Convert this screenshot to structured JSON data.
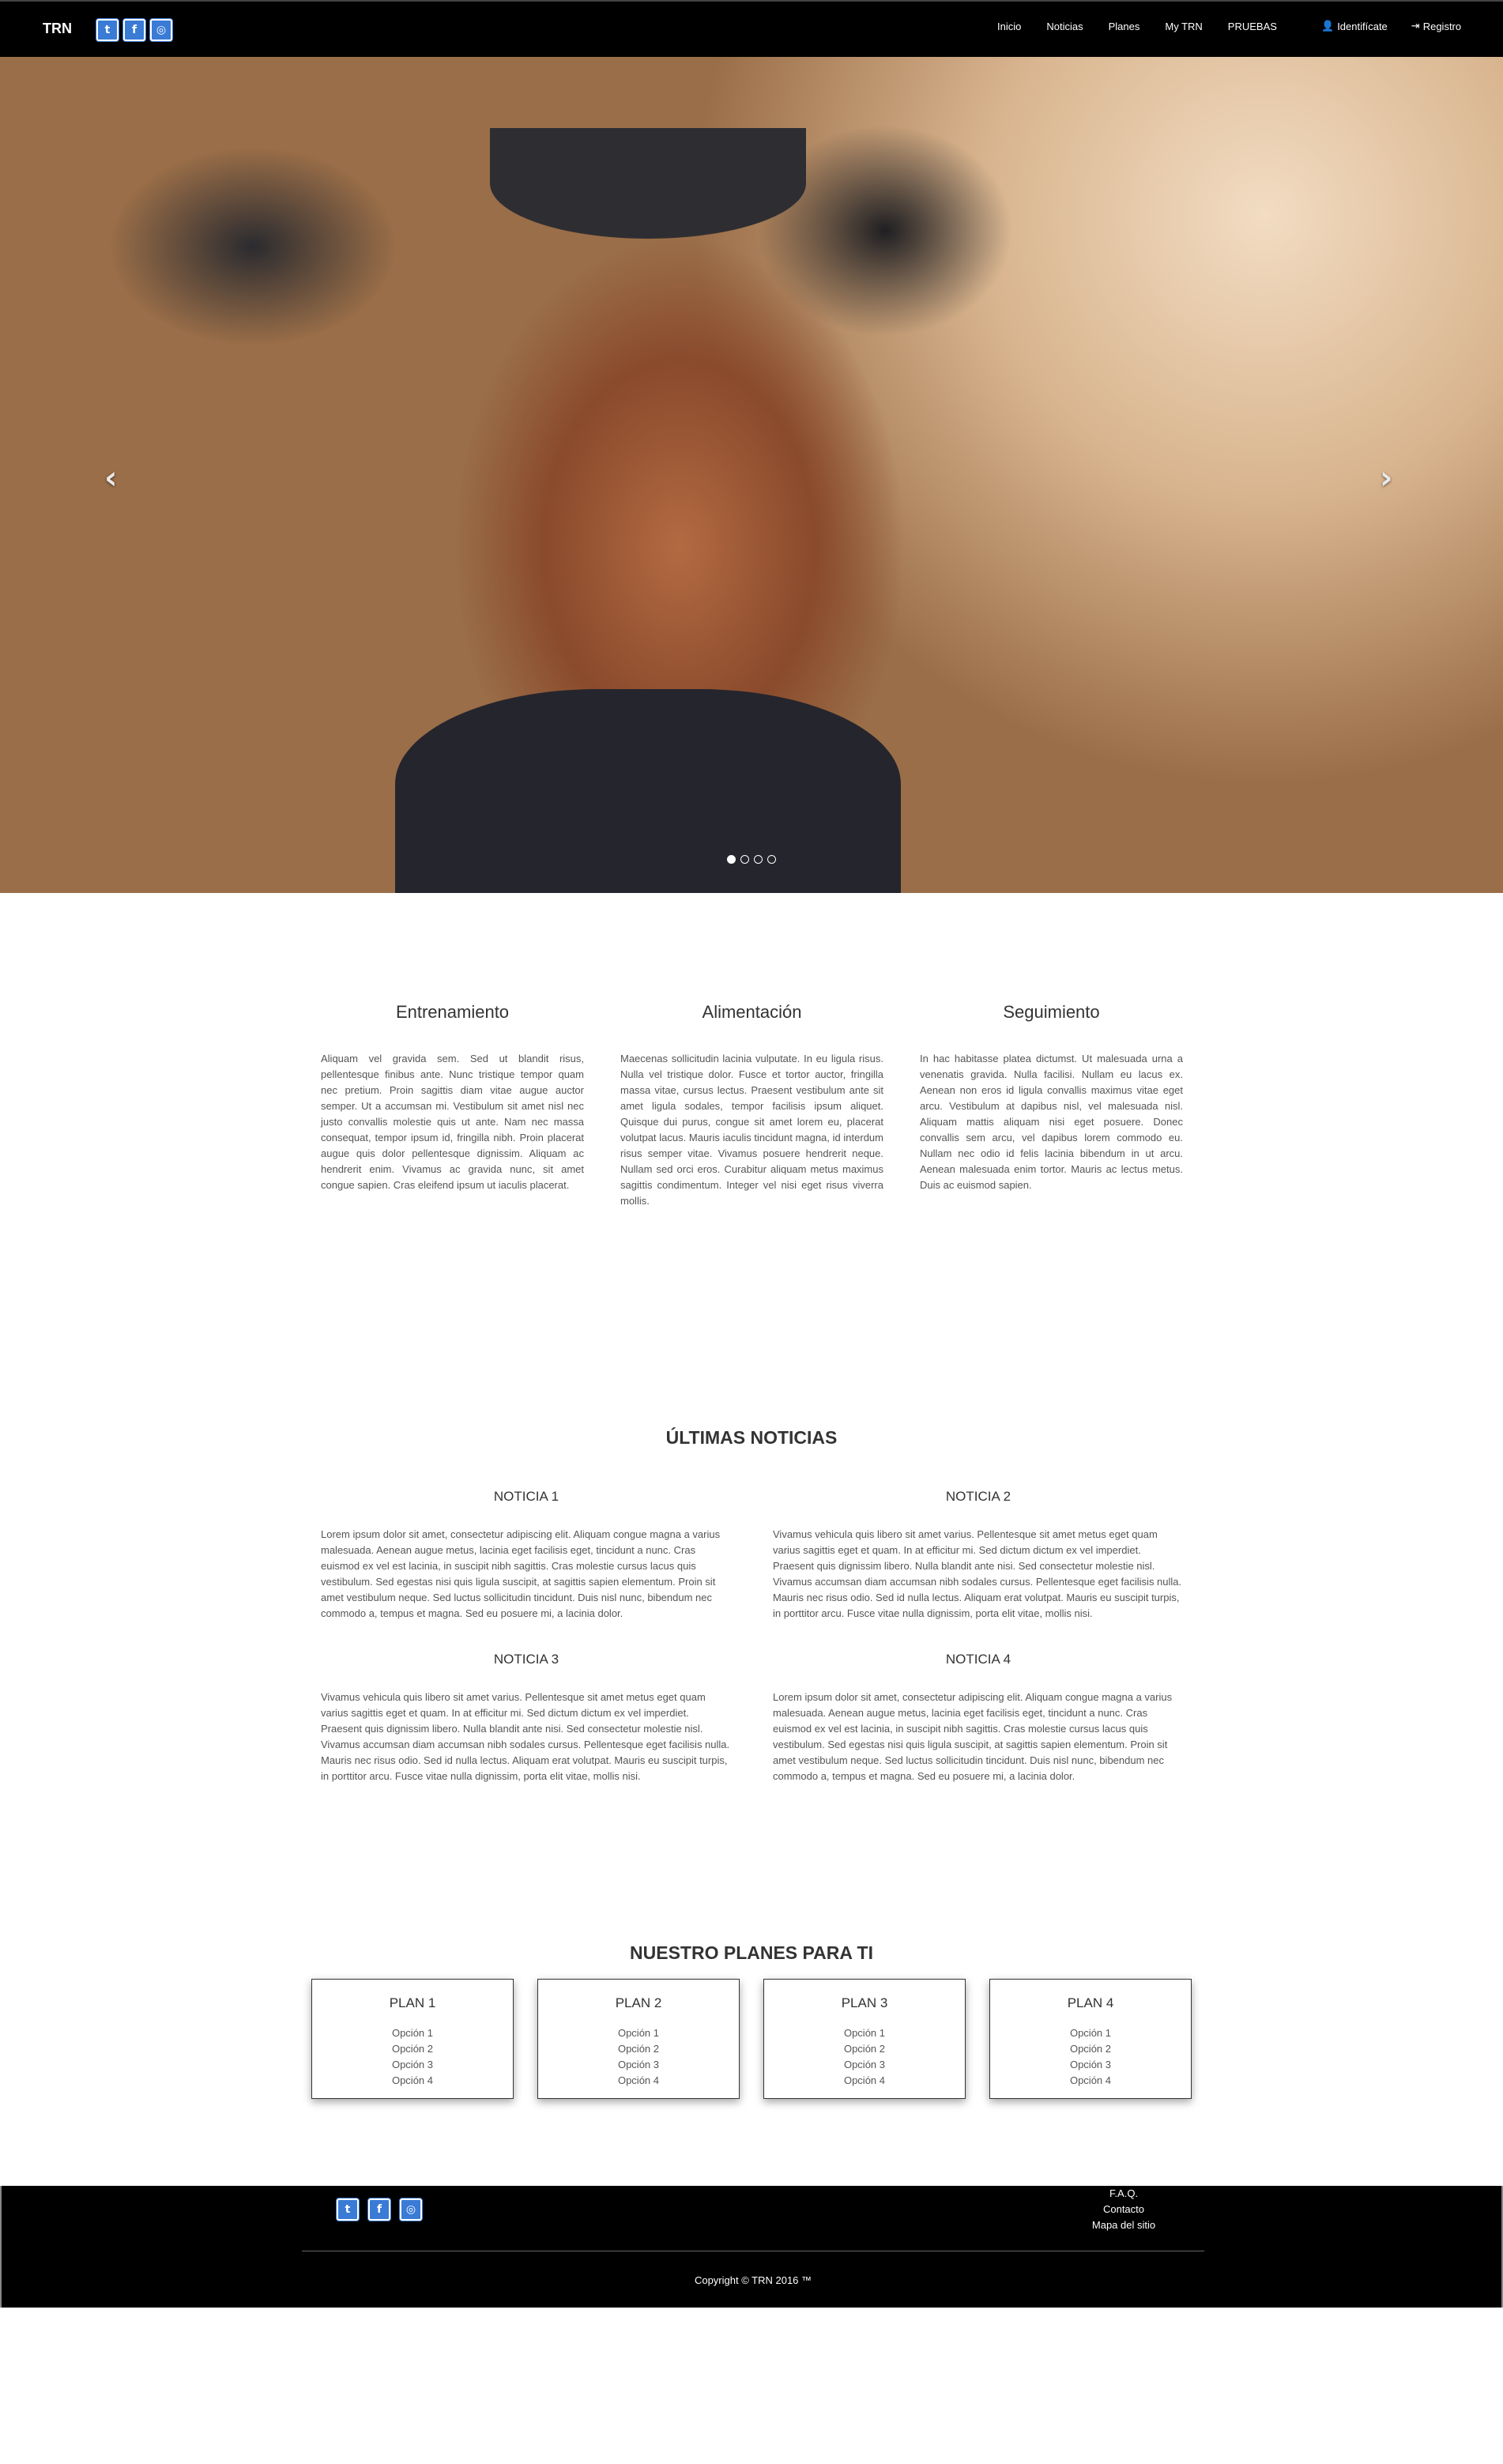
{
  "navbar": {
    "brand": "TRN",
    "social": [
      {
        "icon": "twitter-icon",
        "glyph": "t"
      },
      {
        "icon": "facebook-icon",
        "glyph": "f"
      },
      {
        "icon": "instagram-icon",
        "glyph": "◎"
      }
    ],
    "links": [
      "Inicio",
      "Noticias",
      "Planes",
      "My TRN",
      "PRUEBAS"
    ],
    "login": {
      "icon": "user-icon",
      "label": "Identifícate"
    },
    "register": {
      "icon": "login-icon",
      "label": "Registro"
    }
  },
  "carousel": {
    "prev_glyph": "‹",
    "next_glyph": "›",
    "slides": 4,
    "active_slide": 1
  },
  "features": [
    {
      "title": "Entrenamiento",
      "text": "Aliquam vel gravida sem. Sed ut blandit risus, pellentesque finibus ante. Nunc tristique tempor quam nec pretium. Proin sagittis diam vitae augue auctor semper. Ut a accumsan mi. Vestibulum sit amet nisl nec justo convallis molestie quis ut ante. Nam nec massa consequat, tempor ipsum id, fringilla nibh. Proin placerat augue quis dolor pellentesque dignissim. Aliquam ac hendrerit enim. Vivamus ac gravida nunc, sit amet congue sapien. Cras eleifend ipsum ut iaculis placerat."
    },
    {
      "title": "Alimentación",
      "text": "Maecenas sollicitudin lacinia vulputate. In eu ligula risus. Nulla vel tristique dolor. Fusce et tortor auctor, fringilla massa vitae, cursus lectus. Praesent vestibulum ante sit amet ligula sodales, tempor facilisis ipsum aliquet. Quisque dui purus, congue sit amet lorem eu, placerat volutpat lacus. Mauris iaculis tincidunt magna, id interdum risus semper vitae. Vivamus posuere hendrerit neque. Nullam sed orci eros. Curabitur aliquam metus maximus sagittis condimentum. Integer vel nisi eget risus viverra mollis."
    },
    {
      "title": "Seguimiento",
      "text": "In hac habitasse platea dictumst. Ut malesuada urna a venenatis gravida. Nulla facilisi. Nullam eu lacus ex. Aenean non eros id ligula convallis maximus vitae eget arcu. Vestibulum at dapibus nisl, vel malesuada nisl. Aliquam mattis aliquam nisi eget posuere. Donec convallis sem arcu, vel dapibus lorem commodo eu. Nullam nec odio id felis lacinia bibendum in ut arcu. Aenean malesuada enim tortor. Mauris ac lectus metus. Duis ac euismod sapien."
    }
  ],
  "news": {
    "title": "ÚLTIMAS NOTICIAS",
    "items": [
      {
        "title": "NOTICIA 1",
        "text": "Lorem ipsum dolor sit amet, consectetur adipiscing elit. Aliquam congue magna a varius malesuada. Aenean augue metus, lacinia eget facilisis eget, tincidunt a nunc. Cras euismod ex vel est lacinia, in suscipit nibh sagittis. Cras molestie cursus lacus quis vestibulum. Sed egestas nisi quis ligula suscipit, at sagittis sapien elementum. Proin sit amet vestibulum neque. Sed luctus sollicitudin tincidunt. Duis nisl nunc, bibendum nec commodo a, tempus et magna. Sed eu posuere mi, a lacinia dolor."
      },
      {
        "title": "NOTICIA 2",
        "text": "Vivamus vehicula quis libero sit amet varius. Pellentesque sit amet metus eget quam varius sagittis eget et quam. In at efficitur mi. Sed dictum dictum ex vel imperdiet. Praesent quis dignissim libero. Nulla blandit ante nisi. Sed consectetur molestie nisl. Vivamus accumsan diam accumsan nibh sodales cursus. Pellentesque eget facilisis nulla. Mauris nec risus odio. Sed id nulla lectus. Aliquam erat volutpat. Mauris eu suscipit turpis, in porttitor arcu. Fusce vitae nulla dignissim, porta elit vitae, mollis nisi."
      },
      {
        "title": "NOTICIA 3",
        "text": "Vivamus vehicula quis libero sit amet varius. Pellentesque sit amet metus eget quam varius sagittis eget et quam. In at efficitur mi. Sed dictum dictum ex vel imperdiet. Praesent quis dignissim libero. Nulla blandit ante nisi. Sed consectetur molestie nisl. Vivamus accumsan diam accumsan nibh sodales cursus. Pellentesque eget facilisis nulla. Mauris nec risus odio. Sed id nulla lectus. Aliquam erat volutpat. Mauris eu suscipit turpis, in porttitor arcu. Fusce vitae nulla dignissim, porta elit vitae, mollis nisi."
      },
      {
        "title": "NOTICIA 4",
        "text": "Lorem ipsum dolor sit amet, consectetur adipiscing elit. Aliquam congue magna a varius malesuada. Aenean augue metus, lacinia eget facilisis eget, tincidunt a nunc. Cras euismod ex vel est lacinia, in suscipit nibh sagittis. Cras molestie cursus lacus quis vestibulum. Sed egestas nisi quis ligula suscipit, at sagittis sapien elementum. Proin sit amet vestibulum neque. Sed luctus sollicitudin tincidunt. Duis nisl nunc, bibendum nec commodo a, tempus et magna. Sed eu posuere mi, a lacinia dolor."
      }
    ]
  },
  "plans": {
    "title": "NUESTRO PLANES PARA TI",
    "items": [
      {
        "title": "PLAN 1",
        "options": [
          "Opción 1",
          "Opción 2",
          "Opción 3",
          "Opción 4"
        ]
      },
      {
        "title": "PLAN 2",
        "options": [
          "Opción 1",
          "Opción 2",
          "Opción 3",
          "Opción 4"
        ]
      },
      {
        "title": "PLAN 3",
        "options": [
          "Opción 1",
          "Opción 2",
          "Opción 3",
          "Opción 4"
        ]
      },
      {
        "title": "PLAN 4",
        "options": [
          "Opción 1",
          "Opción 2",
          "Opción 3",
          "Opción 4"
        ]
      }
    ]
  },
  "footer": {
    "social": [
      {
        "icon": "twitter-icon",
        "glyph": "t"
      },
      {
        "icon": "facebook-icon",
        "glyph": "f"
      },
      {
        "icon": "instagram-icon",
        "glyph": "◎"
      }
    ],
    "links": [
      "F.A.Q.",
      "Contacto",
      "Mapa del sitio"
    ],
    "copyright": "Copyright © TRN 2016 ™"
  },
  "colors": {
    "navbar_bg": "#000000",
    "social_accent": "#3a7bd5",
    "page_bg": "#ffffff"
  }
}
